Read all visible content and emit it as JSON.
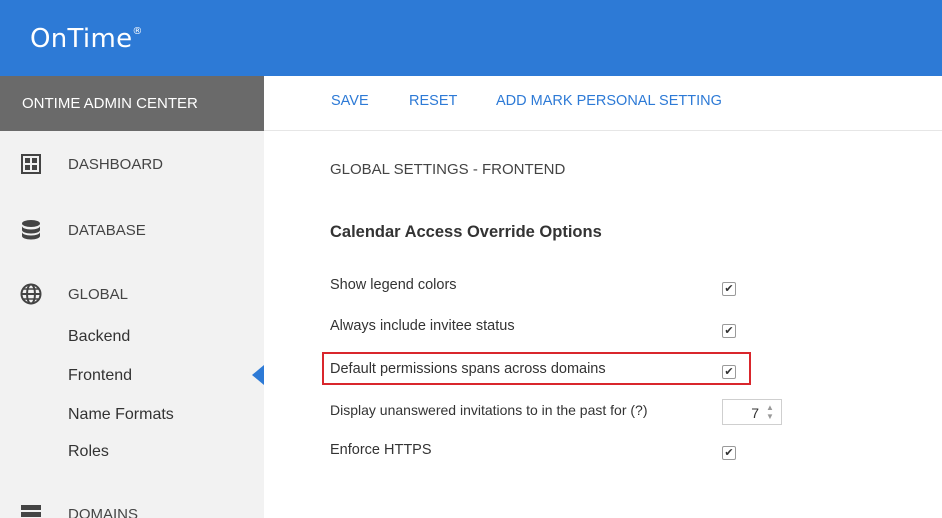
{
  "app": {
    "logo": "OnTime",
    "trademark": "®"
  },
  "sidebar": {
    "header": "ONTIME ADMIN CENTER",
    "items": [
      {
        "label": "DASHBOARD",
        "icon": "dashboard-icon"
      },
      {
        "label": "DATABASE",
        "icon": "database-icon"
      },
      {
        "label": "GLOBAL",
        "icon": "globe-icon"
      },
      {
        "label": "DOMAINS",
        "icon": "domains-icon"
      }
    ],
    "global_sub": [
      {
        "label": "Backend"
      },
      {
        "label": "Frontend",
        "active": true
      },
      {
        "label": "Name Formats"
      },
      {
        "label": "Roles"
      }
    ]
  },
  "toolbar": {
    "save": "SAVE",
    "reset": "RESET",
    "add_mark": "ADD MARK PERSONAL SETTING"
  },
  "main": {
    "title": "GLOBAL SETTINGS - FRONTEND",
    "section": "Calendar Access Override Options",
    "settings": [
      {
        "label": "Show legend colors",
        "checked": "✔"
      },
      {
        "label": "Always include invitee status",
        "checked": "✔"
      },
      {
        "label": "Default permissions spans across domains",
        "checked": "✔",
        "highlighted": true
      },
      {
        "label": "Display unanswered invitations to in the past for (?)",
        "value": "7"
      },
      {
        "label": "Enforce HTTPS",
        "checked": "✔"
      }
    ]
  },
  "colors": {
    "brand": "#2d7ad6",
    "sidebar_header": "#6a6a6a",
    "highlight": "#d9262c"
  }
}
